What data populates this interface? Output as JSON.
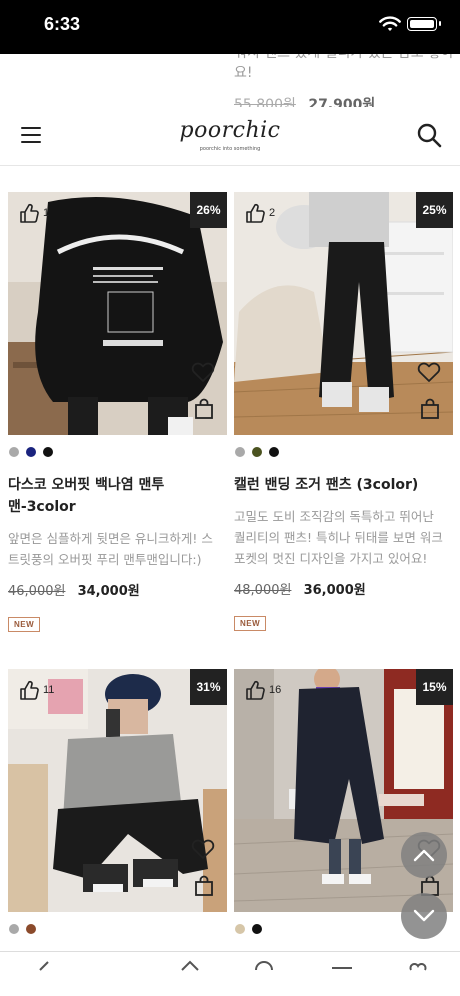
{
  "status_bar": {
    "time": "6:33"
  },
  "ghost_product": {
    "desc_lines": [
      "워치 센스 있게 걸리가 있는 남오 좋아",
      "요!"
    ],
    "original_price": "55,800원",
    "sale_price": "27,900원"
  },
  "header": {
    "logo": "poorchic",
    "logo_sub": "poorchic into something",
    "menu_icon": "hamburger-menu-icon",
    "search_icon": "search-icon"
  },
  "products": [
    {
      "likes": "1",
      "discount": "26%",
      "swatches": [
        "#a9a9a9",
        "#1a237e",
        "#111111"
      ],
      "name_lines": [
        "다스코 오버핏 백나염 맨투",
        "맨-3color"
      ],
      "desc_lines": [
        "앞면은 심플하게 뒷면은 유니크하게! 스",
        "트릿풍의 오버핏 푸리 맨투맨입니다:)"
      ],
      "original_price": "46,000원",
      "sale_price": "34,000원",
      "badge": "NEW"
    },
    {
      "likes": "2",
      "discount": "25%",
      "swatches": [
        "#a9a9a9",
        "#4b5320",
        "#111111"
      ],
      "name_lines": [
        "캘런 밴딩 조거 팬츠 (3color)"
      ],
      "desc_lines": [
        "고밀도 도비 조직감의 독특하고 뛰어난",
        "퀄리티의 팬츠! 특히나 뒤태를 보면 워크",
        "포켓의 멋진 디자인을 가지고 있어요!"
      ],
      "original_price": "48,000원",
      "sale_price": "36,000원",
      "badge": "NEW"
    },
    {
      "likes": "11",
      "discount": "31%",
      "swatches": [
        "#a9a9a9",
        "#8b4a2b"
      ]
    },
    {
      "likes": "16",
      "discount": "15%",
      "swatches": [
        "#d6c6a8",
        "#111111"
      ]
    }
  ],
  "floating": {
    "up_icon": "chevron-up-icon",
    "down_icon": "chevron-down-icon"
  },
  "colors": {
    "header_bg": "#ffffff",
    "badge_border": "#c98a66",
    "discount_bg": "#222222"
  }
}
